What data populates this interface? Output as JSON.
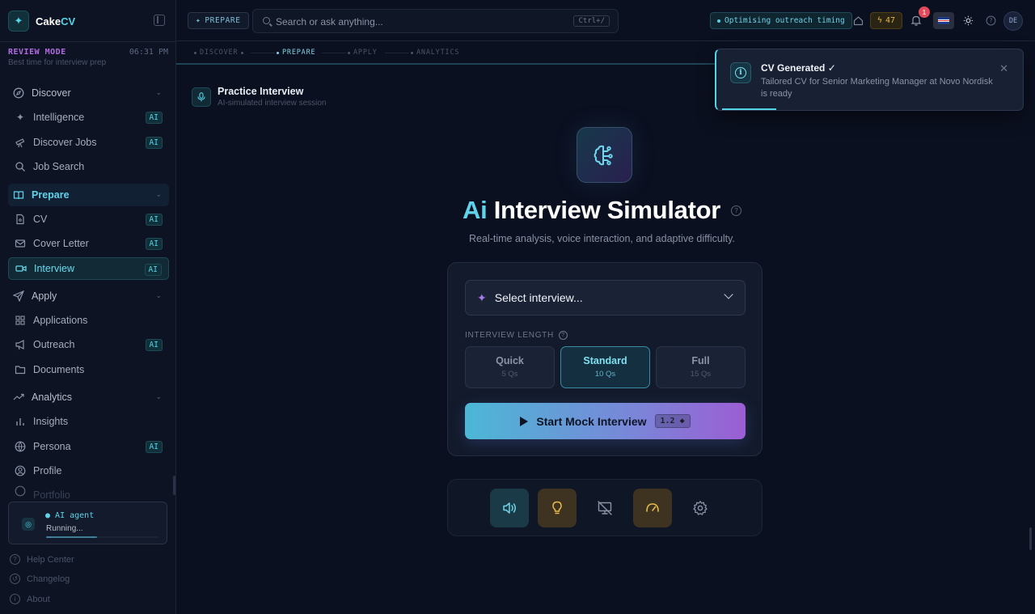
{
  "brand": {
    "name_prefix": "Cake",
    "name_suffix": "CV",
    "logo_icon": "sparkles-icon"
  },
  "review": {
    "mode": "REVIEW MODE",
    "time": "06:31 PM",
    "subtitle": "Best time for interview prep"
  },
  "sidebar": {
    "groups": [
      {
        "label": "Discover",
        "icon": "compass-icon",
        "expanded": true,
        "items": [
          {
            "label": "Intelligence",
            "icon": "sparkles-icon",
            "ai": "AI"
          },
          {
            "label": "Discover Jobs",
            "icon": "telescope-icon",
            "ai": "AI"
          },
          {
            "label": "Job Search",
            "icon": "search-icon",
            "ai": ""
          }
        ]
      },
      {
        "label": "Prepare",
        "icon": "book-icon",
        "expanded": true,
        "items": [
          {
            "label": "CV",
            "icon": "file-icon",
            "ai": "AI"
          },
          {
            "label": "Cover Letter",
            "icon": "mail-icon",
            "ai": "AI"
          },
          {
            "label": "Interview",
            "icon": "video-icon",
            "ai": "AI"
          }
        ]
      },
      {
        "label": "Apply",
        "icon": "send-icon",
        "expanded": true,
        "items": [
          {
            "label": "Applications",
            "icon": "grid-icon",
            "ai": ""
          },
          {
            "label": "Outreach",
            "icon": "megaphone-icon",
            "ai": "AI"
          },
          {
            "label": "Documents",
            "icon": "folder-icon",
            "ai": ""
          }
        ]
      },
      {
        "label": "Analytics",
        "icon": "trend-icon",
        "expanded": true,
        "items": [
          {
            "label": "Insights",
            "icon": "bar-chart-icon",
            "ai": ""
          },
          {
            "label": "Persona",
            "icon": "globe-icon",
            "ai": "AI"
          },
          {
            "label": "Profile",
            "icon": "user-icon",
            "ai": ""
          },
          {
            "label": "Portfolio",
            "icon": "globe-icon",
            "ai": ""
          }
        ]
      }
    ],
    "active_item": "Interview",
    "agent": {
      "title": "AI agent",
      "status": "Running...",
      "progress": 0.45
    },
    "footer": [
      {
        "label": "Help Center",
        "icon": "help-icon"
      },
      {
        "label": "Changelog",
        "icon": "history-icon"
      },
      {
        "label": "About",
        "icon": "info-icon"
      }
    ]
  },
  "topbar": {
    "stage_chip": "PREPARE",
    "search_placeholder": "Search or ask anything...",
    "search_shortcut": "Ctrl+/",
    "activity": "Optimising outreach timing",
    "credits": "47",
    "notifications": "1",
    "language": "en-GB",
    "avatar": "DE"
  },
  "stages": [
    {
      "label": "DISCOVER",
      "state": "done"
    },
    {
      "label": "PREPARE",
      "state": "active"
    },
    {
      "label": "APPLY",
      "state": "pending"
    },
    {
      "label": "ANALYTICS",
      "state": "pending"
    }
  ],
  "section": {
    "title": "Practice Interview",
    "subtitle": "AI-simulated interview session"
  },
  "hero": {
    "title_accent": "Ai",
    "title_rest": "Interview Simulator",
    "subtitle": "Real-time analysis, voice interaction, and adaptive difficulty."
  },
  "setup": {
    "select_placeholder": "Select interview...",
    "length_label": "INTERVIEW LENGTH",
    "lengths": [
      {
        "name": "Quick",
        "count": "5 Qs"
      },
      {
        "name": "Standard",
        "count": "10 Qs"
      },
      {
        "name": "Full",
        "count": "15 Qs"
      }
    ],
    "selected_length": "Standard",
    "start_label": "Start Mock Interview",
    "start_cost": "1.2 ◆"
  },
  "tools": [
    {
      "name": "audio",
      "icon": "speaker-icon"
    },
    {
      "name": "hints",
      "icon": "lightbulb-icon"
    },
    {
      "name": "screen-share",
      "icon": "screen-off-icon"
    },
    {
      "name": "difficulty",
      "icon": "gauge-icon"
    },
    {
      "name": "settings",
      "icon": "gear-icon"
    }
  ],
  "toast": {
    "title": "CV Generated ✓",
    "message": "Tailored CV for Senior Marketing Manager at Novo Nordisk is ready",
    "progress": 0.18
  },
  "colors": {
    "accent": "#52d3e6",
    "purple": "#9b5ed4",
    "amber": "#e8b94a",
    "background": "#0b1020"
  }
}
